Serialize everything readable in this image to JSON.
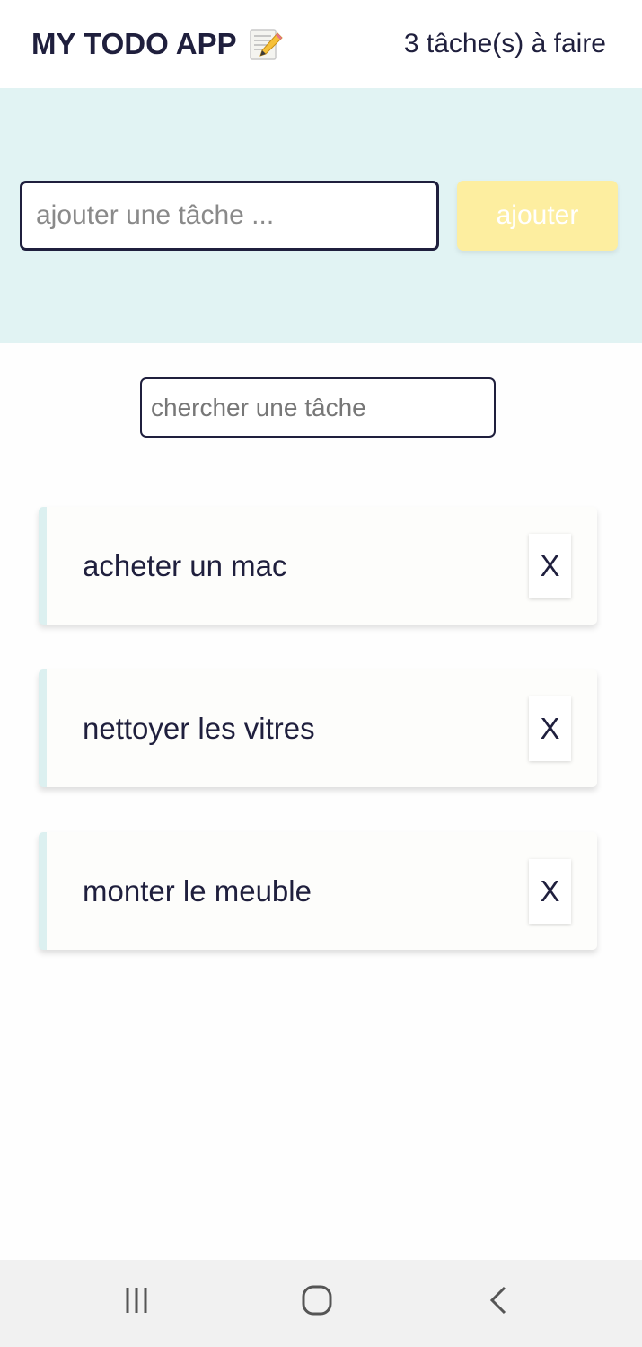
{
  "header": {
    "title": "MY TODO APP",
    "title_icon": "memo-icon",
    "task_count": "3 tâche(s) à faire"
  },
  "add_form": {
    "placeholder": "ajouter une tâche ...",
    "value": "",
    "button_label": "ajouter"
  },
  "search": {
    "placeholder": "chercher une tâche",
    "value": ""
  },
  "todos": [
    {
      "label": "acheter un mac",
      "delete_label": "X"
    },
    {
      "label": "nettoyer les vitres",
      "delete_label": "X"
    },
    {
      "label": "monter le meuble",
      "delete_label": "X"
    }
  ],
  "nav": {
    "recents_icon": "recents-icon",
    "home_icon": "home-icon",
    "back_icon": "back-icon"
  },
  "colors": {
    "text": "#1f1f3d",
    "add_panel_bg": "#e1f3f3",
    "add_button_bg": "#fdeea0",
    "item_accent": "#dcf0f0",
    "nav_bg": "#f1f1f1"
  }
}
